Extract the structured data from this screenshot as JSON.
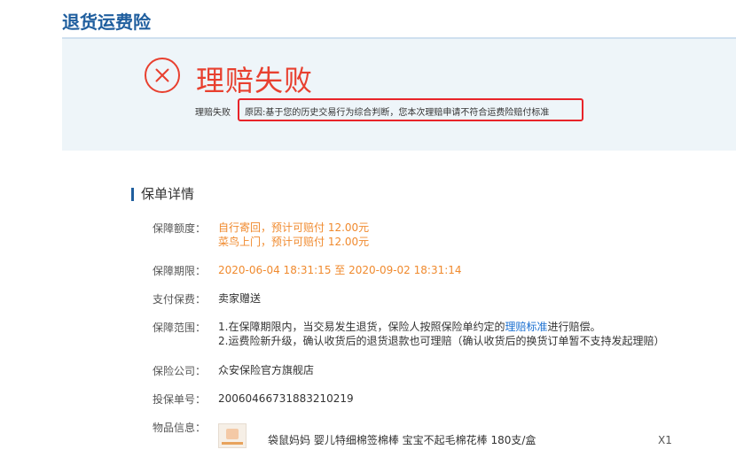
{
  "page": {
    "title": "退货运费险"
  },
  "banner": {
    "status_title": "理赔失败",
    "status_label": "理赔失败",
    "reason": "原因:基于您的历史交易行为综合判断，您本次理赔申请不符合运费险赔付标准",
    "icon": "close-circle-icon",
    "accent_color": "#e8402f"
  },
  "details": {
    "section_title": "保单详情",
    "coverage": {
      "label": "保障额度：",
      "line1": "自行寄回，预计可赔付 12.00元",
      "line2": "菜鸟上门，预计可赔付 12.00元"
    },
    "period": {
      "label": "保障期限：",
      "value": "2020-06-04 18:31:15 至 2020-09-02 18:31:14"
    },
    "premium": {
      "label": "支付保费：",
      "value": "卖家赠送"
    },
    "scope": {
      "label": "保障范围：",
      "line1_prefix": "1.在保障期限内，当交易发生退货，保险人按照保险单约定的",
      "line1_link": "理赔标准",
      "line1_suffix": "进行赔偿。",
      "line2": "2.运费险新升级，确认收货后的退货退款也可理赔（确认收货后的换货订单暂不支持发起理赔）"
    },
    "company": {
      "label": "保险公司：",
      "value": "众安保险官方旗舰店"
    },
    "policy_no": {
      "label": "投保单号：",
      "value": "20060466731883210219"
    },
    "item": {
      "label": "物品信息：",
      "name": "袋鼠妈妈 婴儿特细棉签棉棒 宝宝不起毛棉花棒 180支/盒",
      "qty": "X1"
    }
  }
}
